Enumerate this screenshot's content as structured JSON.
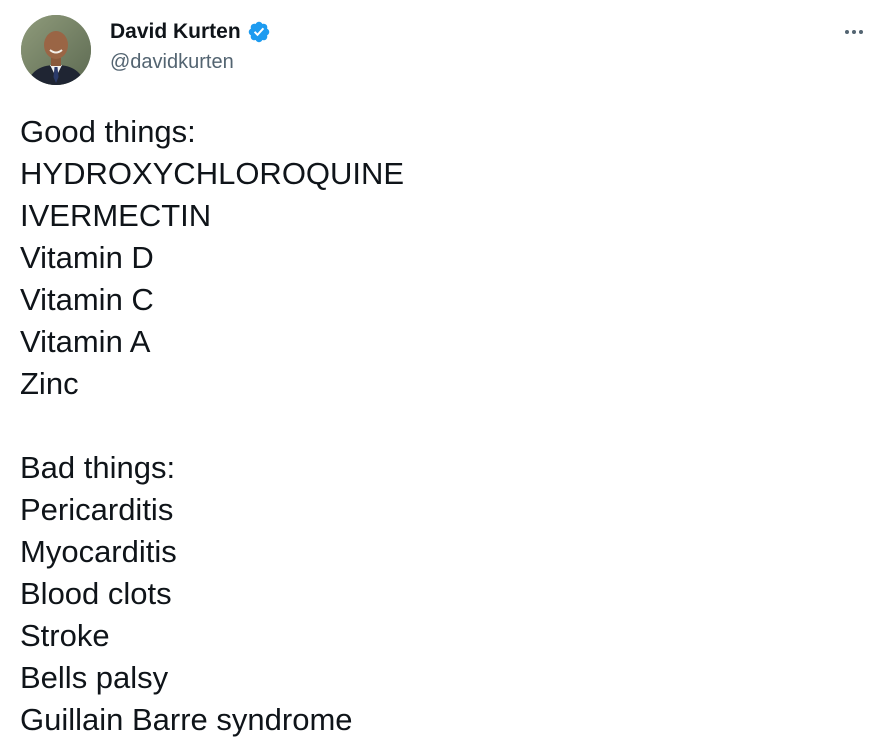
{
  "author": {
    "display_name": "David Kurten",
    "handle": "@davidkurten",
    "verified": true,
    "verified_icon": "verified-badge-icon",
    "avatar_icon": "profile-photo"
  },
  "menu": {
    "icon": "more-options-icon"
  },
  "colors": {
    "text": "#0f1419",
    "secondary_text": "#536471",
    "verified_blue": "#1d9bf0",
    "background": "#ffffff"
  },
  "tweet": {
    "good_header": "Good things:",
    "good_items": [
      "HYDROXYCHLOROQUINE",
      "IVERMECTIN",
      "Vitamin D",
      "Vitamin C",
      "Vitamin A",
      "Zinc"
    ],
    "bad_header": "Bad things:",
    "bad_items": [
      "Pericarditis",
      "Myocarditis",
      "Blood clots",
      "Stroke",
      "Bells palsy",
      "Guillain Barre syndrome"
    ]
  }
}
